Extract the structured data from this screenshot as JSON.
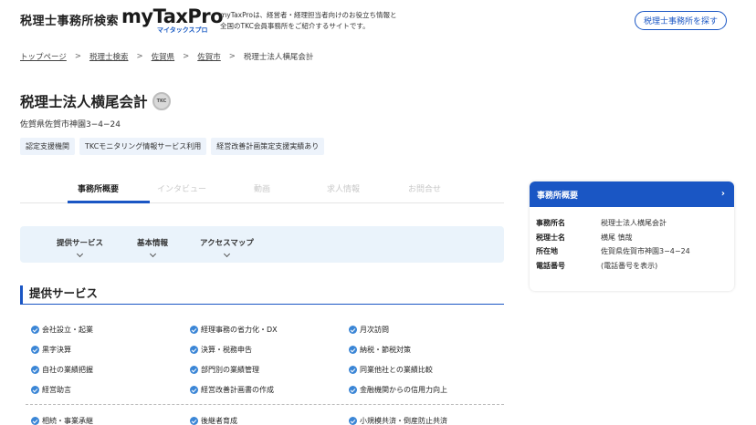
{
  "header": {
    "brand_jp": "税理士事務所検索",
    "brand_en": "myTaxPro",
    "brand_kana": "マイタックスプロ",
    "tagline_line1": "myTaxProは、経営者・経理担当者向けのお役立ち情報と",
    "tagline_line2": "全国のTKC会員事務所をご紹介するサイトです。",
    "find_button": "税理士事務所を探す"
  },
  "breadcrumb": [
    {
      "label": "トップページ"
    },
    {
      "label": "税理士検索"
    },
    {
      "label": "佐賀県"
    },
    {
      "label": "佐賀市"
    },
    {
      "label": "税理士法人横尾会計"
    }
  ],
  "breadcrumb_separator": ">",
  "office": {
    "name": "税理士法人横尾会計",
    "badge_text": "TKC",
    "address": "佐賀県佐賀市神園3−4−24",
    "tags": [
      "認定支援機関",
      "TKCモニタリング情報サービス利用",
      "経営改善計画策定支援実績あり"
    ]
  },
  "tabs": [
    {
      "label": "事務所概要",
      "active": true
    },
    {
      "label": "インタビュー",
      "active": false
    },
    {
      "label": "動画",
      "active": false
    },
    {
      "label": "求人情報",
      "active": false
    },
    {
      "label": "お問合せ",
      "active": false
    }
  ],
  "subnav": [
    {
      "label": "提供サービス"
    },
    {
      "label": "基本情報"
    },
    {
      "label": "アクセスマップ"
    }
  ],
  "section": {
    "title": "提供サービス"
  },
  "services": [
    [
      "会社設立・起業",
      "経理事務の省力化・DX",
      "月次訪問"
    ],
    [
      "黒字決算",
      "決算・税務申告",
      "納税・節税対策"
    ],
    [
      "自社の業績把握",
      "部門別の業績管理",
      "同業他社との業績比較"
    ],
    [
      "経営助言",
      "経営改善計画書の作成",
      "金融機関からの信用力向上"
    ],
    [
      "相続・事業承継",
      "後継者育成",
      "小規模共済・倒産防止共済"
    ]
  ],
  "side_card": {
    "title": "事務所概要",
    "arrow": "›",
    "rows": [
      {
        "key": "事務所名",
        "value": "税理士法人横尾会計"
      },
      {
        "key": "税理士名",
        "value": "横尾 慎哉"
      },
      {
        "key": "所在地",
        "value": "佐賀県佐賀市神園3−4−24"
      },
      {
        "key": "電話番号",
        "value": "(電話番号を表示)"
      }
    ]
  },
  "colors": {
    "accent": "#1a56c4",
    "check": "#3b86d6",
    "subnav_bg": "#eaf3fb",
    "tag_bg": "#edf3fb"
  }
}
